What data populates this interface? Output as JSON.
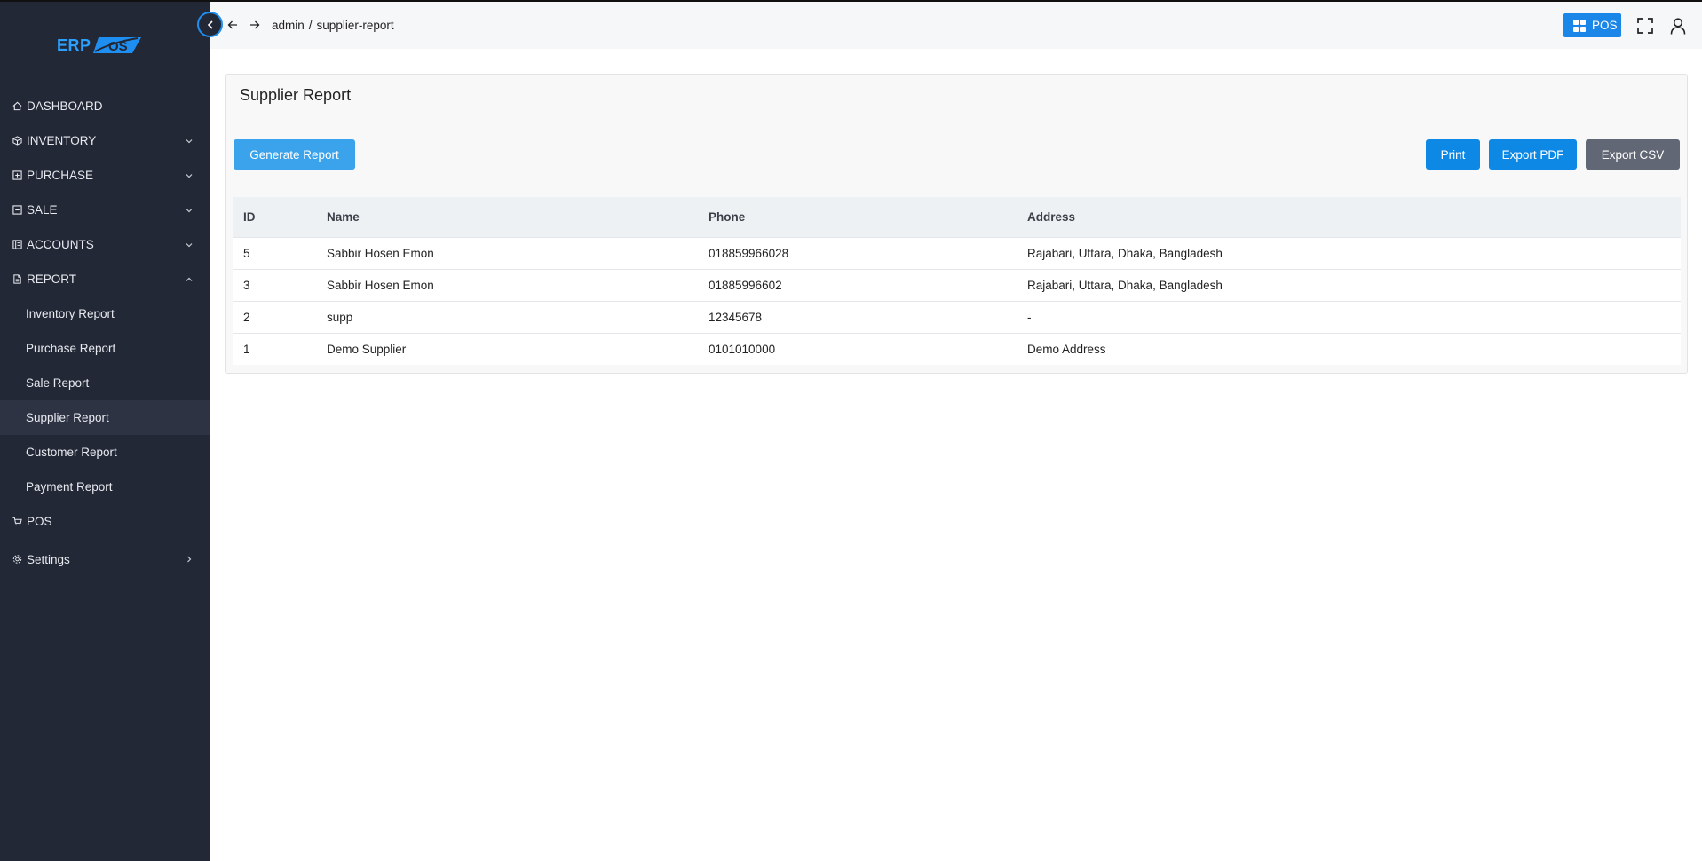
{
  "colors": {
    "sidebar_bg": "#232836",
    "accent": "#1a86e8",
    "csv_button": "#616774"
  },
  "logo": {
    "text_erp": "ERP",
    "text_os": "OS"
  },
  "sidebar": {
    "items": [
      {
        "label": "DASHBOARD",
        "icon": "home-icon"
      },
      {
        "label": "INVENTORY",
        "icon": "box-icon"
      },
      {
        "label": "PURCHASE",
        "icon": "plus-square-icon"
      },
      {
        "label": "SALE",
        "icon": "minus-square-icon"
      },
      {
        "label": "ACCOUNTS",
        "icon": "ledger-icon"
      },
      {
        "label": "REPORT",
        "icon": "document-icon"
      }
    ],
    "report_sub": [
      {
        "label": "Inventory Report"
      },
      {
        "label": "Purchase Report"
      },
      {
        "label": "Sale Report"
      },
      {
        "label": "Supplier Report",
        "active": true
      },
      {
        "label": "Customer Report"
      },
      {
        "label": "Payment Report"
      }
    ],
    "pos": {
      "label": "POS",
      "icon": "cart-icon"
    },
    "settings": {
      "label": "Settings",
      "icon": "gear-icon"
    }
  },
  "topbar": {
    "breadcrumb": [
      "admin",
      "/",
      "supplier-report"
    ],
    "pos_button": "POS"
  },
  "card": {
    "title": "Supplier Report",
    "buttons": {
      "generate": "Generate Report",
      "print": "Print",
      "export_pdf": "Export PDF",
      "export_csv": "Export CSV"
    }
  },
  "table": {
    "headers": [
      "ID",
      "Name",
      "Phone",
      "Address"
    ],
    "rows": [
      [
        "5",
        "Sabbir Hosen Emon",
        "018859966028",
        "Rajabari, Uttara, Dhaka, Bangladesh"
      ],
      [
        "3",
        "Sabbir Hosen Emon",
        "01885996602",
        "Rajabari, Uttara, Dhaka, Bangladesh"
      ],
      [
        "2",
        "supp",
        "12345678",
        "-"
      ],
      [
        "1",
        "Demo Supplier",
        "0101010000",
        "Demo Address"
      ]
    ]
  }
}
